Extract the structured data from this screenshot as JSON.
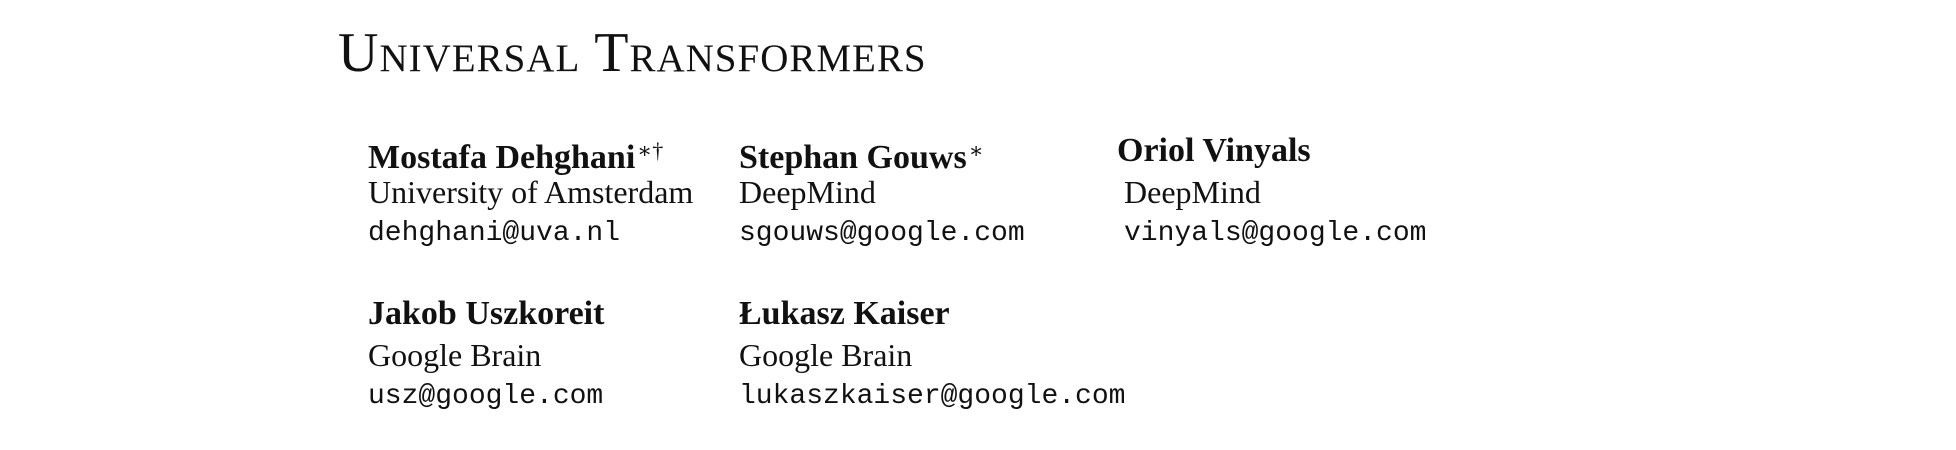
{
  "paper": {
    "title": "Universal Transformers",
    "authors": [
      {
        "name": "Mostafa Dehghani",
        "marks": "∗†",
        "affiliation": "University of Amsterdam",
        "email": "dehghani@uva.nl"
      },
      {
        "name": "Stephan Gouws",
        "marks": "∗",
        "affiliation": "DeepMind",
        "email": "sgouws@google.com"
      },
      {
        "name": "Oriol Vinyals",
        "marks": "",
        "affiliation": "DeepMind",
        "email": "vinyals@google.com"
      },
      {
        "name": "Jakob Uszkoreit",
        "marks": "",
        "affiliation": "Google Brain",
        "email": "usz@google.com"
      },
      {
        "name": "Łukasz Kaiser",
        "marks": "",
        "affiliation": "Google Brain",
        "email": "lukaszkaiser@google.com"
      }
    ]
  }
}
